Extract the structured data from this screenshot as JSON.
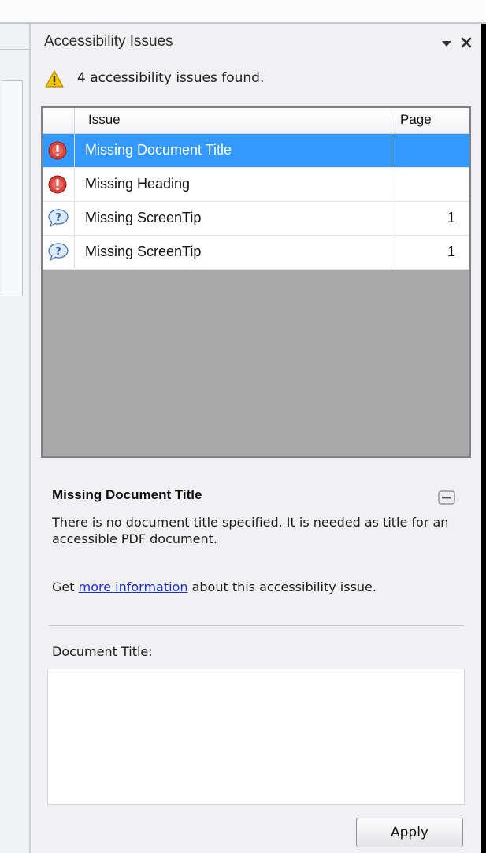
{
  "pane": {
    "title": "Accessibility Issues",
    "icons": {
      "dropdown": "dropdown-arrow-icon",
      "close": "close-icon"
    }
  },
  "summary": {
    "icon": "warning-icon",
    "text": "4 accessibility issues found."
  },
  "table": {
    "columns": [
      "Issue",
      "Page"
    ],
    "rows": [
      {
        "icon": "error-icon",
        "issue": "Missing Document Title",
        "page": "",
        "selected": true
      },
      {
        "icon": "error-icon",
        "issue": "Missing Heading",
        "page": "",
        "selected": false
      },
      {
        "icon": "help-icon",
        "issue": "Missing ScreenTip",
        "page": "1",
        "selected": false
      },
      {
        "icon": "help-icon",
        "issue": "Missing ScreenTip",
        "page": "1",
        "selected": false
      }
    ]
  },
  "detail": {
    "heading": "Missing Document Title",
    "description": "There is no document title specified. It is needed as title for an accessible PDF document.",
    "more_prefix": "Get ",
    "more_link": "more information",
    "more_suffix": " about this accessibility issue.",
    "field_label": "Document Title:",
    "field_value": "",
    "apply_label": "Apply"
  },
  "colors": {
    "selection": "#3399ff",
    "link": "#1a2fd8",
    "error": "#d9433b",
    "warning": "#f5c400"
  }
}
